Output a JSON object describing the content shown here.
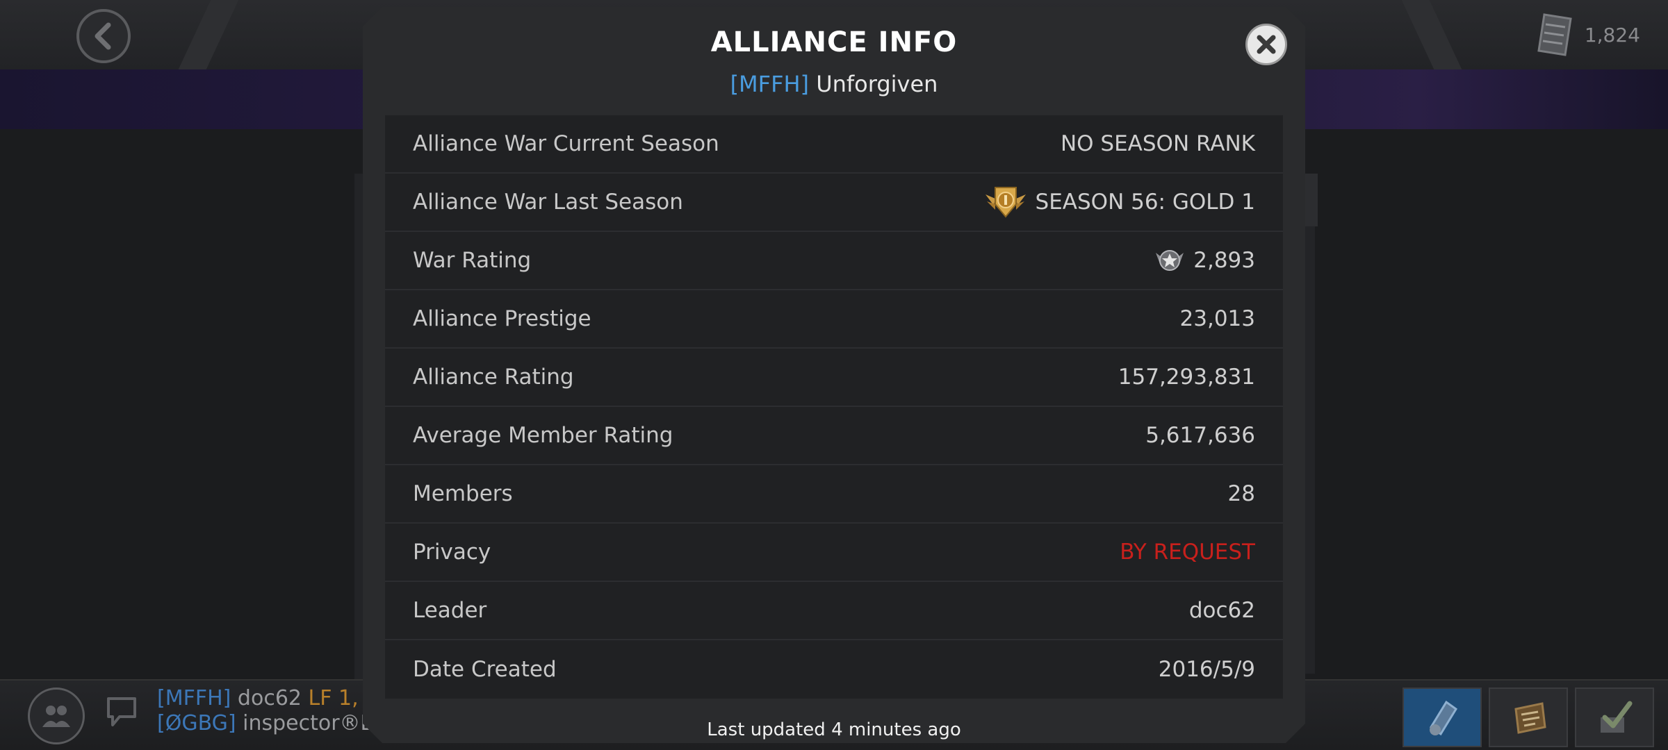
{
  "header": {
    "currency_amount": "1,824"
  },
  "modal": {
    "title": "ALLIANCE INFO",
    "alliance_tag": "[MFFH]",
    "alliance_name": "Unforgiven",
    "rows": [
      {
        "label": "Alliance War Current Season",
        "value": "NO SEASON RANK"
      },
      {
        "label": "Alliance War Last Season",
        "value": "SEASON 56: GOLD 1",
        "icon": "gold-rank-badge-icon"
      },
      {
        "label": "War Rating",
        "value": "2,893",
        "icon": "war-rating-star-icon"
      },
      {
        "label": "Alliance Prestige",
        "value": "23,013"
      },
      {
        "label": "Alliance Rating",
        "value": "157,293,831"
      },
      {
        "label": "Average Member Rating",
        "value": "5,617,636"
      },
      {
        "label": "Members",
        "value": "28"
      },
      {
        "label": "Privacy",
        "value": "BY REQUEST",
        "color": "#c8201c"
      },
      {
        "label": "Leader",
        "value": "doc62"
      },
      {
        "label": "Date Created",
        "value": "2016/5/9"
      }
    ],
    "footer": "Last updated 4 minutes ago"
  },
  "chat": {
    "lines": [
      {
        "tag": "[MFFH]",
        "name": "doc62",
        "extra": "LF 1,"
      },
      {
        "tag": "[ØGBG]",
        "name": "inspector®Dr",
        "extra": ""
      }
    ]
  },
  "colors": {
    "accent_blue": "#4a9de0",
    "privacy_red": "#c8201c",
    "modal_bg": "#2a2b2d"
  }
}
